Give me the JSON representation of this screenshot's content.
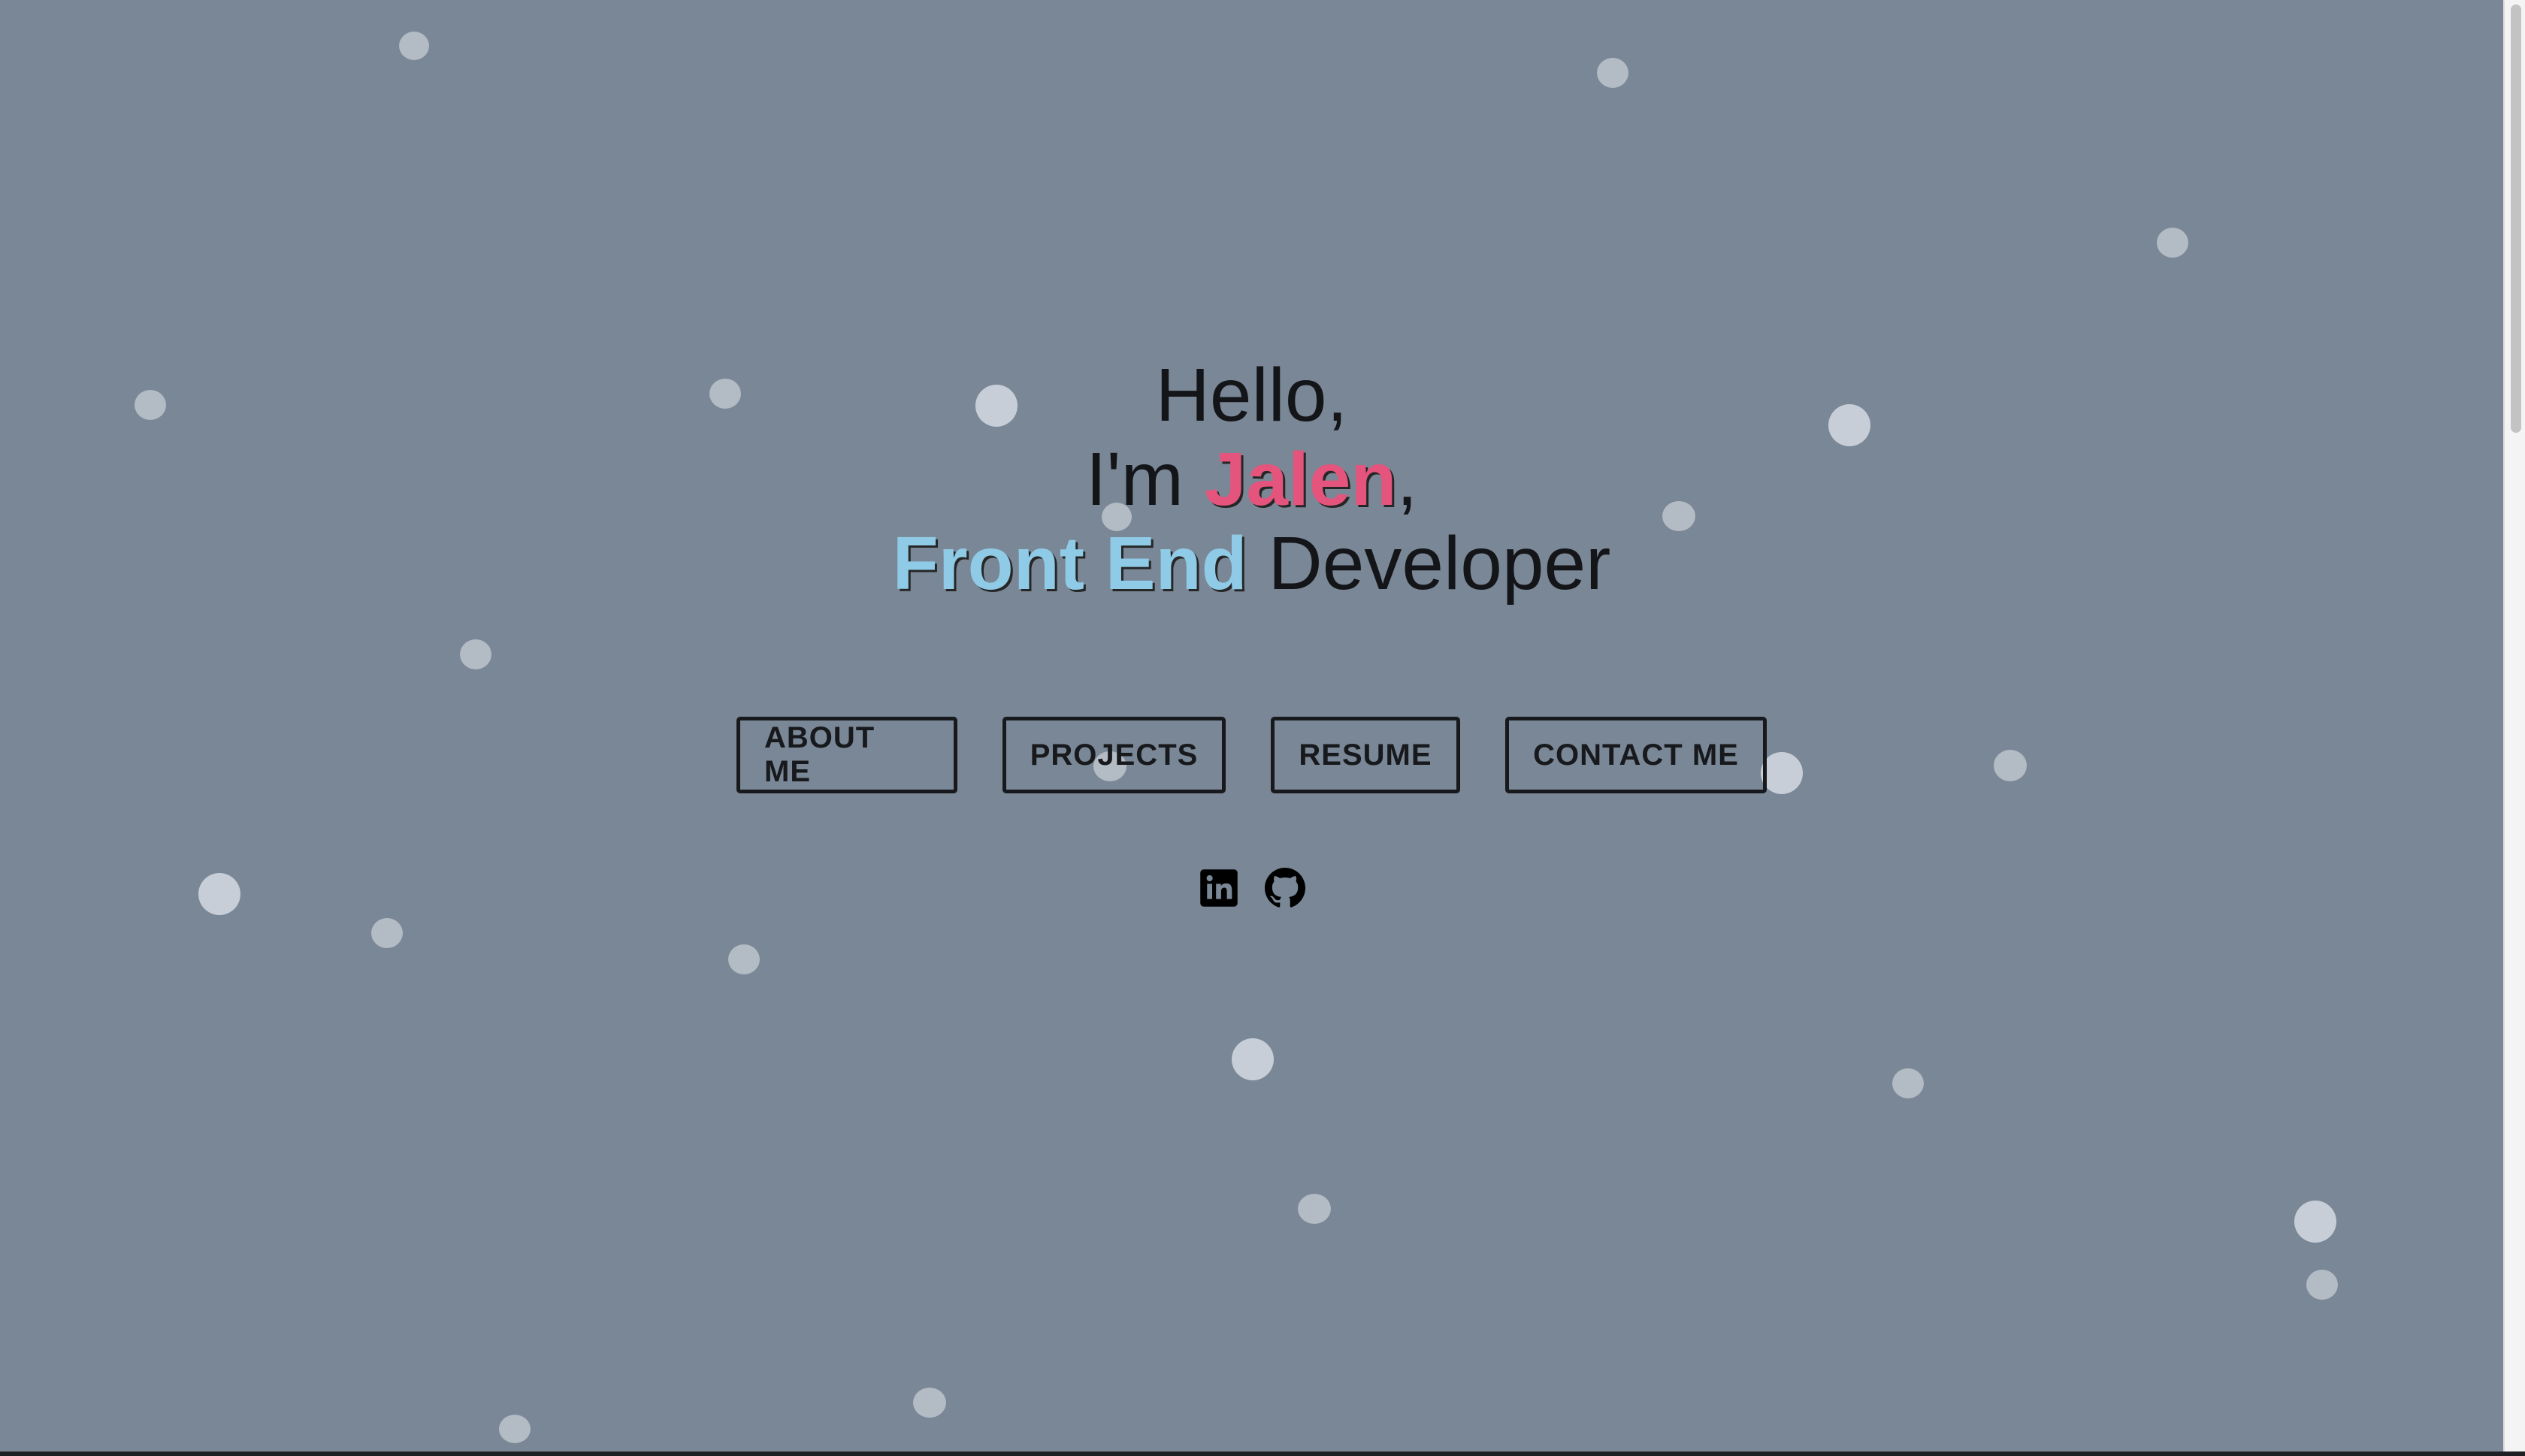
{
  "hero": {
    "greeting": "Hello,",
    "intro_prefix": "I'm ",
    "name": "Jalen",
    "intro_suffix": ",",
    "role_accent": "Front End",
    "role_rest": " Developer"
  },
  "nav": {
    "about": "ABOUT ME",
    "projects": "PROJECTS",
    "resume": "RESUME",
    "contact": "CONTACT ME"
  },
  "social": {
    "icons": [
      "linkedin-icon",
      "github-icon"
    ]
  },
  "colors": {
    "background": "#7a8796",
    "name_accent": "#e5547d",
    "role_accent": "#8fcbe6",
    "text": "#141518"
  }
}
